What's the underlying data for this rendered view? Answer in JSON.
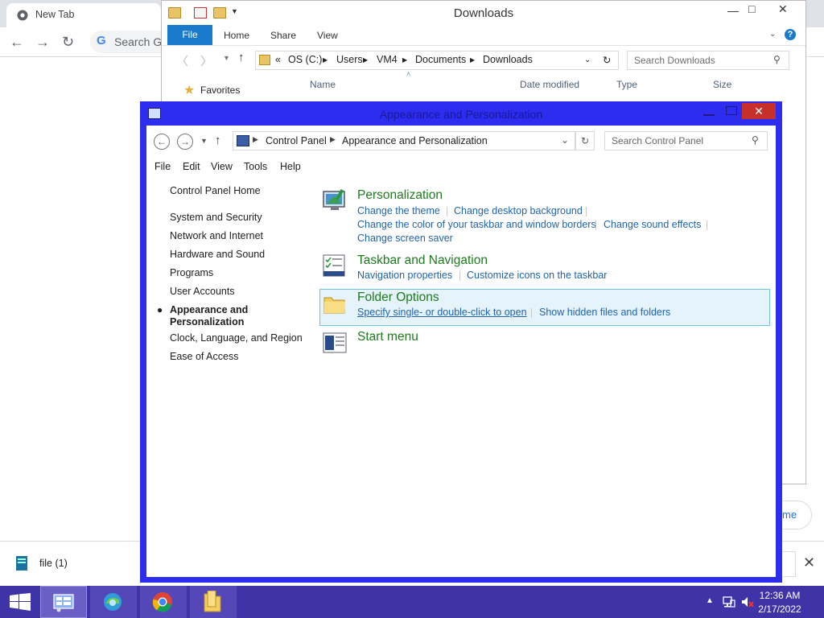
{
  "chrome": {
    "tab_title": "New Tab",
    "search_placeholder": "Search Go",
    "right_stub_text": "me",
    "download_item": "file (1)"
  },
  "explorer": {
    "title": "Downloads",
    "ribbon_tabs": [
      "File",
      "Home",
      "Share",
      "View"
    ],
    "path": [
      "«",
      "OS (C:)",
      "Users",
      "VM4",
      "Documents",
      "Downloads"
    ],
    "search_placeholder": "Search Downloads",
    "columns": [
      "Name",
      "Date modified",
      "Type",
      "Size"
    ],
    "nav_favorites": "Favorites"
  },
  "control_panel": {
    "title": "Appearance and Personalization",
    "breadcrumb": [
      "Control Panel",
      "Appearance and Personalization"
    ],
    "search_placeholder": "Search Control Panel",
    "menu": [
      "File",
      "Edit",
      "View",
      "Tools",
      "Help"
    ],
    "sidebar": {
      "home": "Control Panel Home",
      "items": [
        "System and Security",
        "Network and Internet",
        "Hardware and Sound",
        "Programs",
        "User Accounts",
        "Appearance and\nPersonalization",
        "Clock, Language, and Region",
        "Ease of Access"
      ],
      "active_index": 5
    },
    "categories": {
      "personalization": {
        "title": "Personalization",
        "links": [
          "Change the theme",
          "Change desktop background",
          "Change the color of your taskbar and window borders",
          "Change sound effects",
          "Change screen saver"
        ]
      },
      "taskbar": {
        "title": "Taskbar and Navigation",
        "links": [
          "Navigation properties",
          "Customize icons on the taskbar"
        ]
      },
      "folder_options": {
        "title": "Folder Options",
        "links": [
          "Specify single- or double-click to open",
          "Show hidden files and folders"
        ]
      },
      "start_menu": {
        "title": "Start menu"
      }
    }
  },
  "taskbar": {
    "time": "12:36 AM",
    "date": "2/17/2022"
  },
  "colors": {
    "cp_border": "#2d2df0",
    "taskbar": "#3f33a8",
    "link": "#1f63ad",
    "category_title": "#1e7a1e"
  }
}
